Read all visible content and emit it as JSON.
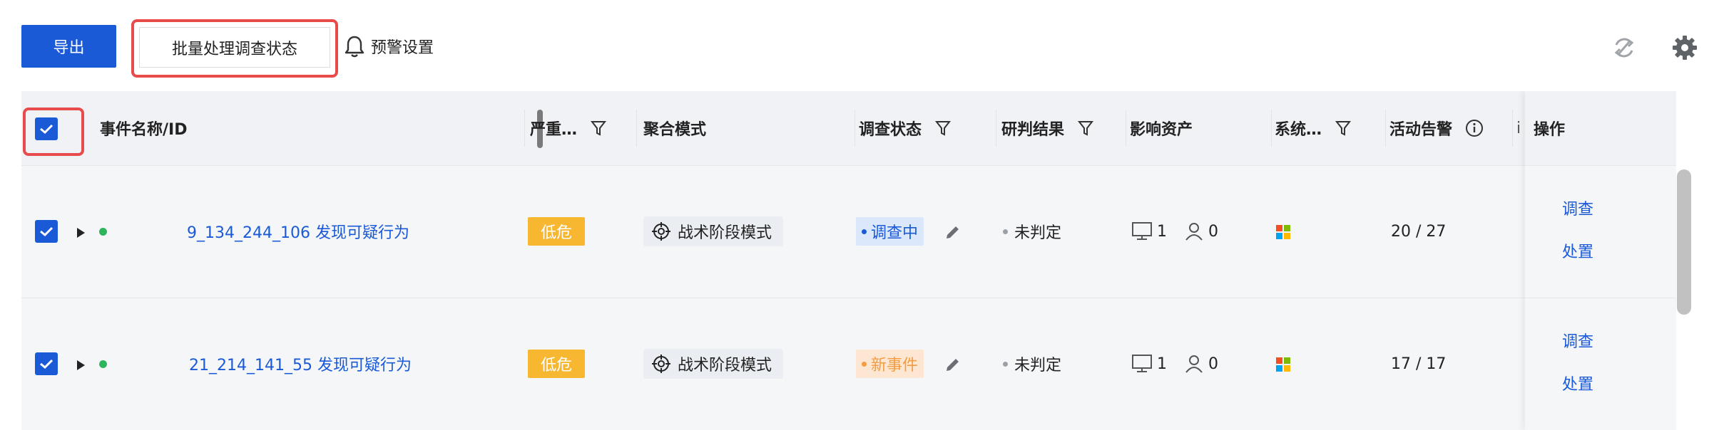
{
  "toolbar": {
    "export_label": "导出",
    "batch_label": "批量处理调查状态",
    "warning_label": "预警设置"
  },
  "table": {
    "columns": {
      "name": "事件名称/ID",
      "severity": "严重…",
      "mode": "聚合模式",
      "status": "调查状态",
      "result": "研判结果",
      "assets": "影响资产",
      "system": "系统…",
      "alerts": "活动告警",
      "truncated": "i",
      "ops": "操作"
    },
    "rows": [
      {
        "name": "9_134_244_106 发现可疑行为",
        "severity": "低危",
        "mode": "战术阶段模式",
        "status": "调查中",
        "result": "未判定",
        "hosts": "1",
        "users": "0",
        "alerts": "20 / 27",
        "op_investigate": "调查",
        "op_handle": "处置"
      },
      {
        "name": "21_214_141_55 发现可疑行为",
        "severity": "低危",
        "mode": "战术阶段模式",
        "status": "新事件",
        "result": "未判定",
        "hosts": "1",
        "users": "0",
        "alerts": "17 / 17",
        "op_investigate": "调查",
        "op_handle": "处置"
      }
    ]
  },
  "colors": {
    "primary": "#1a5ad7",
    "highlight": "#e84b4b",
    "severity_low": "#f7b731",
    "status_investigating": "#1a5ad7",
    "status_new": "#f39c40",
    "online_dot": "#2db55d"
  },
  "icons": [
    "bell-icon",
    "refresh-icon",
    "gear-icon",
    "filter-icon",
    "info-icon",
    "check-icon",
    "expand-arrow-icon",
    "target-icon",
    "edit-icon",
    "monitor-icon",
    "user-icon",
    "windows-icon"
  ]
}
